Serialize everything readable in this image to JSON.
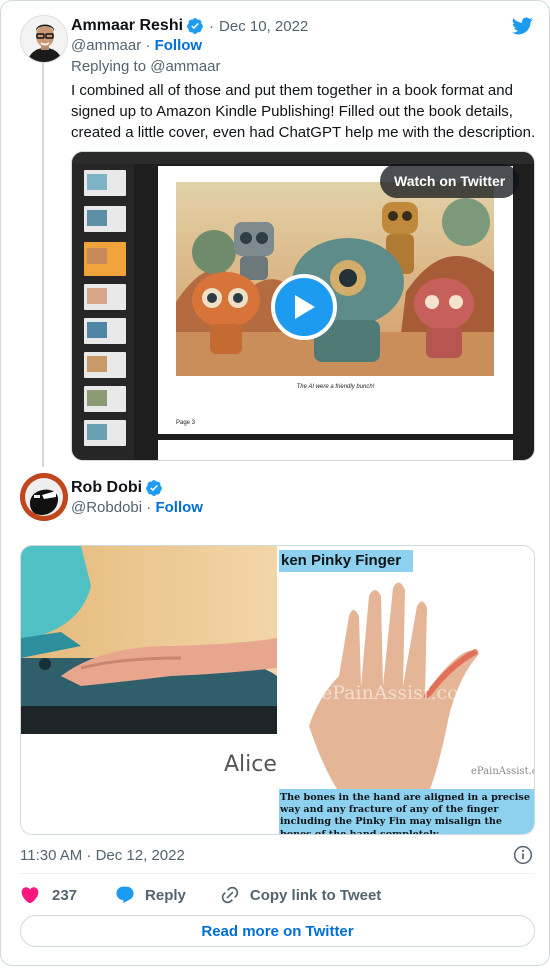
{
  "colors": {
    "accent": "#1d9bf0",
    "link": "#006fd6",
    "secondary_text": "#536471",
    "like": "#f91880",
    "border": "#cfd9de"
  },
  "tweet_parent": {
    "display_name": "Ammaar Reshi",
    "date": "Dec 10, 2022",
    "handle": "@ammaar",
    "follow_label": "Follow",
    "replying_to": "Replying to @ammaar",
    "text": "I combined all of those and put them together in a book format and signed up to Amazon Kindle Publishing! Filled out the book details, created a little cover, even had ChatGPT help me with the description.",
    "video": {
      "badge": "Watch on Twitter",
      "caption": "The AI were a friendly bunch!",
      "page_label": "Page 3"
    }
  },
  "tweet_main": {
    "display_name": "Rob Dobi",
    "handle": "@Robdobi",
    "follow_label": "Follow",
    "media_left_text": "Alice",
    "media_right_title": "ken Pinky Finger",
    "media_right_watermark": "ePainAssist.com",
    "media_right_watermark_small": "ePainAssist.co",
    "media_right_text": "The bones in the hand are aligned in a precise way and any fracture of any of the finger including the Pinky Fin may misalign the bones of the hand completely.",
    "timestamp": "11:30 AM · Dec 12, 2022",
    "like_count": "237",
    "reply_label": "Reply",
    "copy_label": "Copy link to Tweet",
    "read_more_label": "Read more on Twitter"
  },
  "icons": [
    "verified-badge-icon",
    "twitter-bird-icon",
    "play-icon",
    "info-icon",
    "heart-icon",
    "reply-bubble-icon",
    "link-icon"
  ],
  "separator_dot": "·"
}
